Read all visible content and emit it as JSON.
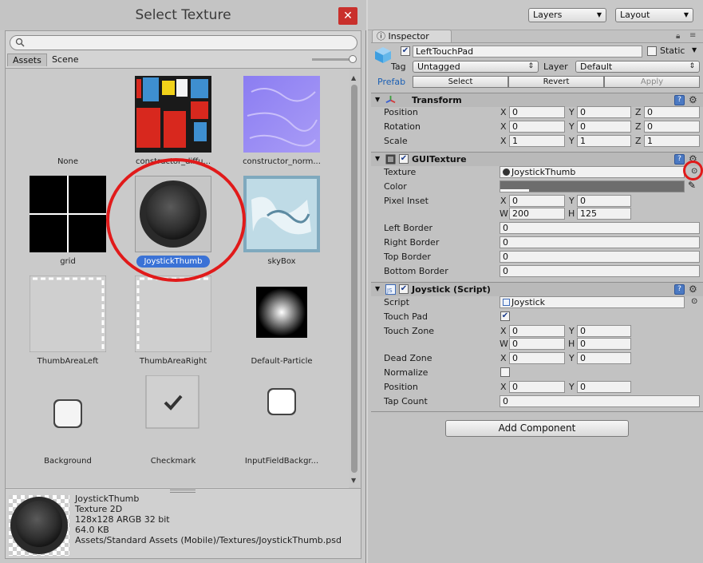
{
  "picker": {
    "title": "Select Texture",
    "close": "✕",
    "search": {
      "value": "",
      "placeholder": ""
    },
    "tabs": [
      "Assets",
      "Scene"
    ],
    "items": [
      {
        "name": "None"
      },
      {
        "name": "constructor_diffu..."
      },
      {
        "name": "constructor_norm..."
      },
      {
        "name": "grid"
      },
      {
        "name": "JoystickThumb",
        "selected": true
      },
      {
        "name": "skyBox"
      },
      {
        "name": "ThumbAreaLeft"
      },
      {
        "name": "ThumbAreaRight"
      },
      {
        "name": "Default-Particle"
      },
      {
        "name": "Background"
      },
      {
        "name": "Checkmark"
      },
      {
        "name": "InputFieldBackgr..."
      }
    ],
    "preview": {
      "name": "JoystickThumb",
      "type": "Texture 2D",
      "format": "128x128  ARGB 32 bit",
      "size": "64.0 KB",
      "path": "Assets/Standard Assets (Mobile)/Textures/JoystickThumb.psd"
    },
    "highlight_color": "#e11a1a",
    "selection_color": "#3a72d6"
  },
  "topbar": {
    "layers": "Layers",
    "layout": "Layout"
  },
  "inspector": {
    "tab": "Inspector",
    "object": {
      "name": "LeftTouchPad",
      "static_label": "Static",
      "tag_label": "Tag",
      "tag": "Untagged",
      "layer_label": "Layer",
      "layer": "Default",
      "prefab_label": "Prefab",
      "prefab_buttons": [
        "Select",
        "Revert",
        "Apply"
      ]
    },
    "transform": {
      "title": "Transform",
      "rows": [
        {
          "label": "Position",
          "x": "0",
          "y": "0",
          "z": "0"
        },
        {
          "label": "Rotation",
          "x": "0",
          "y": "0",
          "z": "0"
        },
        {
          "label": "Scale",
          "x": "1",
          "y": "1",
          "z": "1"
        }
      ]
    },
    "guitexture": {
      "title": "GUITexture",
      "texture_label": "Texture",
      "texture_value": "JoystickThumb",
      "color_label": "Color",
      "pixel_inset_label": "Pixel Inset",
      "inset": {
        "x": "0",
        "y": "0",
        "w": "200",
        "h": "125"
      },
      "borders": [
        {
          "label": "Left Border",
          "value": "0"
        },
        {
          "label": "Right Border",
          "value": "0"
        },
        {
          "label": "Top Border",
          "value": "0"
        },
        {
          "label": "Bottom Border",
          "value": "0"
        }
      ]
    },
    "joystick": {
      "title": "Joystick (Script)",
      "script_label": "Script",
      "script_value": "Joystick",
      "touch_pad_label": "Touch Pad",
      "touch_zone_label": "Touch Zone",
      "touch_zone": {
        "x": "0",
        "y": "0",
        "w": "0",
        "h": "0"
      },
      "dead_zone_label": "Dead Zone",
      "dead_zone": {
        "x": "0",
        "y": "0"
      },
      "normalize_label": "Normalize",
      "position_label": "Position",
      "position": {
        "x": "0",
        "y": "0"
      },
      "tap_count_label": "Tap Count",
      "tap_count": "0"
    },
    "add_component": "Add Component"
  },
  "axis_labels": {
    "x": "X",
    "y": "Y",
    "z": "Z",
    "w": "W",
    "h": "H"
  }
}
